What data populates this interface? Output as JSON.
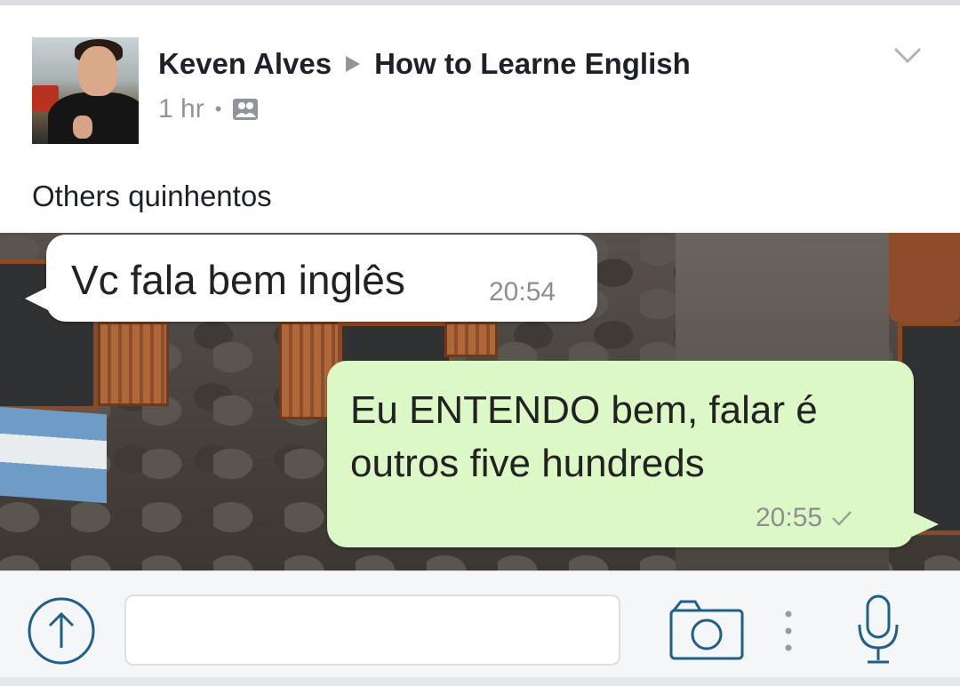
{
  "post": {
    "author": "Keven Alves",
    "group": "How to Learne English",
    "time": "1 hr",
    "separator": "•",
    "privacy_icon": "group-icon",
    "menu_icon": "chevron-down-icon",
    "text": "Others quinhentos"
  },
  "chat": {
    "incoming": {
      "text": "Vc fala bem inglês",
      "time": "20:54"
    },
    "outgoing": {
      "text": "Eu ENTENDO bem, falar é outros five hundreds",
      "time": "20:55",
      "status_icon": "check-icon"
    }
  },
  "composer": {
    "upload_icon": "upload-arrow-icon",
    "input_value": "",
    "camera_icon": "camera-icon",
    "more_icon": "more-vertical-icon",
    "mic_icon": "microphone-icon"
  },
  "colors": {
    "incoming_bubble": "#ffffff",
    "outgoing_bubble": "#dcf8c6",
    "icon_blue": "#1f5f8b",
    "meta_gray": "#90949c"
  }
}
